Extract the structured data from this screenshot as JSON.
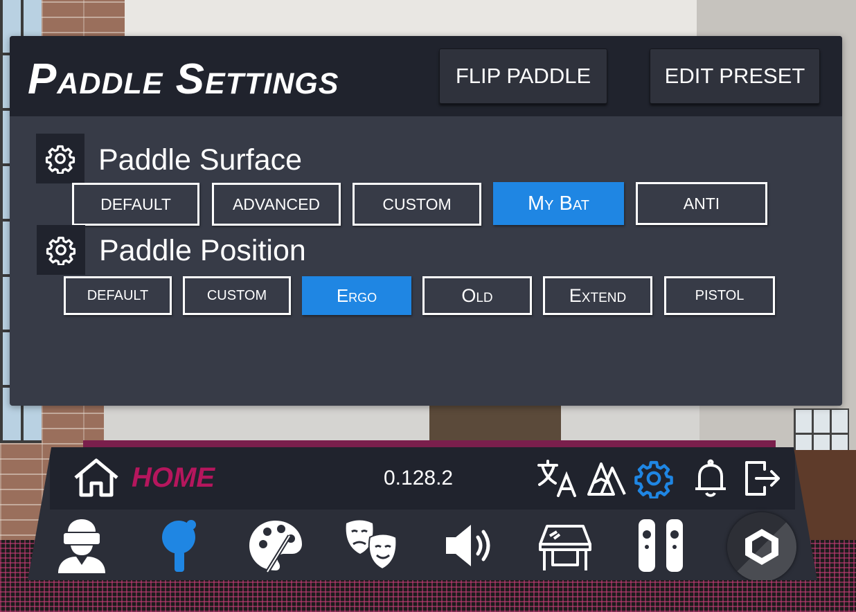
{
  "header": {
    "title": "Paddle Settings",
    "flip_button": "FLIP PADDLE",
    "edit_button": "EDIT PRESET"
  },
  "surface": {
    "label": "Paddle Surface",
    "options": [
      "DEFAULT",
      "ADVANCED",
      "CUSTOM",
      "My Bat",
      "ANTI"
    ],
    "selected": "My Bat"
  },
  "position": {
    "label": "Paddle Position",
    "options": [
      "DEFAULT",
      "CUSTOM",
      "Ergo",
      "Old",
      "Extend",
      "PISTOL"
    ],
    "selected": "Ergo"
  },
  "nav": {
    "home_label": "HOME",
    "version": "0.128.2",
    "top_icons": [
      "language-icon",
      "graphics-icon",
      "settings-icon",
      "notifications-icon",
      "exit-icon"
    ],
    "tabs": [
      "avatar-icon",
      "paddle-icon",
      "customize-icon",
      "emotes-icon",
      "audio-icon",
      "table-icon",
      "controllers-icon",
      "unity-icon"
    ],
    "active_top_icon": "settings-icon",
    "active_tab": "paddle-icon"
  },
  "colors": {
    "accent_blue": "#1f86e3",
    "home_pink": "#b5165d",
    "panel_bg": "#373b47",
    "header_bg": "#20232d"
  }
}
